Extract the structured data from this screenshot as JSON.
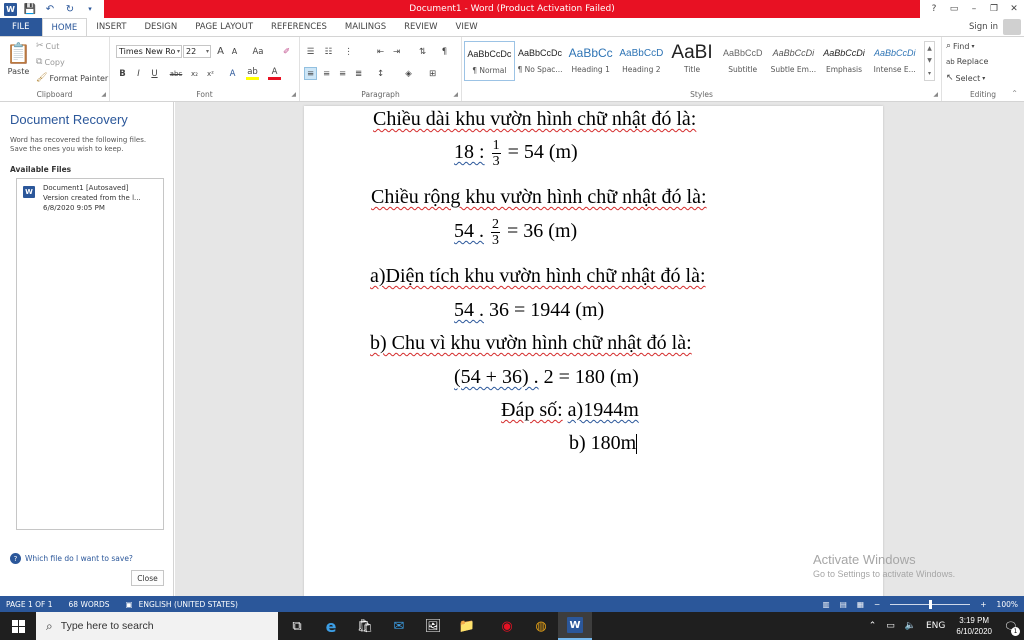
{
  "titlebar": {
    "title": "Document1 - Word (Product Activation Failed)",
    "controls": [
      "?",
      "▭",
      "–",
      "❐",
      "✕"
    ]
  },
  "tabs": [
    {
      "label": "FILE"
    },
    {
      "label": "HOME"
    },
    {
      "label": "INSERT"
    },
    {
      "label": "DESIGN"
    },
    {
      "label": "PAGE LAYOUT"
    },
    {
      "label": "REFERENCES"
    },
    {
      "label": "MAILINGS"
    },
    {
      "label": "REVIEW"
    },
    {
      "label": "VIEW"
    }
  ],
  "signin": "Sign in",
  "ribbon": {
    "clipboard": {
      "label": "Clipboard",
      "paste": "Paste",
      "cut": "Cut",
      "copy": "Copy",
      "format_painter": "Format Painter"
    },
    "font": {
      "label": "Font",
      "font_name": "Times New Ro",
      "font_size": "22",
      "bold": "B",
      "italic": "I",
      "underline": "U",
      "strike": "abc",
      "subscript": "x₂",
      "superscript": "x²",
      "grow": "A",
      "shrink": "A",
      "case": "Aa"
    },
    "paragraph": {
      "label": "Paragraph"
    },
    "styles": {
      "label": "Styles",
      "items": [
        {
          "sample": "AaBbCcDc",
          "name": "¶ Normal"
        },
        {
          "sample": "AaBbCcDc",
          "name": "¶ No Spac..."
        },
        {
          "sample": "AaBbCc",
          "name": "Heading 1"
        },
        {
          "sample": "AaBbCcD",
          "name": "Heading 2"
        },
        {
          "sample": "AaBI",
          "name": "Title"
        },
        {
          "sample": "AaBbCcD",
          "name": "Subtitle"
        },
        {
          "sample": "AaBbCcDi",
          "name": "Subtle Em..."
        },
        {
          "sample": "AaBbCcDi",
          "name": "Emphasis"
        },
        {
          "sample": "AaBbCcDi",
          "name": "Intense E..."
        }
      ]
    },
    "editing": {
      "label": "Editing",
      "find": "Find",
      "replace": "Replace",
      "select": "Select"
    }
  },
  "recovery": {
    "title": "Document Recovery",
    "description": "Word has recovered the following files. Save the ones you wish to keep.",
    "available_files": "Available Files",
    "file": {
      "name": "Document1  [Autosaved]",
      "version": "Version created from the l...",
      "date": "6/8/2020 9:05 PM"
    },
    "help_link": "Which file do I want to save?",
    "close": "Close"
  },
  "document": {
    "line1": "Chiều dài khu vườn hình chữ nhật đó là:",
    "eq1": {
      "left": "18 :",
      "num": "1",
      "den": "3",
      "right": "= 54 (m)"
    },
    "line2": "Chiều rộng khu vườn hình chữ nhật đó là:",
    "eq2": {
      "left": "54 .",
      "num": "2",
      "den": "3",
      "right": "= 36 (m)"
    },
    "line3": "a)Diện tích khu vườn hình chữ nhật đó là:",
    "eq3": {
      "left": "54 .",
      "right": "36 = 1944 (m)"
    },
    "line4": "b) Chu vì khu vườn hình chữ nhật đó là:",
    "eq4": {
      "left": "(54 + 36) .",
      "right": "2 = 180 (m)"
    },
    "answer_label": "Đáp số:",
    "answer_a": "a)1944m",
    "answer_b": "b) 180m"
  },
  "activate": {
    "title": "Activate Windows",
    "subtitle": "Go to Settings to activate Windows."
  },
  "statusbar": {
    "page": "PAGE 1 OF 1",
    "words": "68 WORDS",
    "language": "ENGLISH (UNITED STATES)",
    "zoom": "100%",
    "zoom_level": 0.5
  },
  "taskbar": {
    "search_placeholder": "Type here to search",
    "lang": "ENG",
    "time": "3:19 PM",
    "date": "6/10/2020",
    "notifications": "1"
  },
  "colors": {
    "accent": "#2b579a",
    "title_red": "#e81123",
    "taskbar": "#1f1f1f"
  }
}
